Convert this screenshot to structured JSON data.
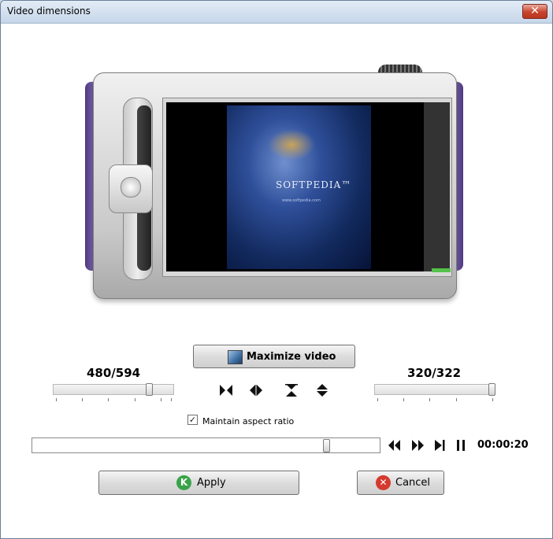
{
  "window": {
    "title": "Video dimensions",
    "close_symbol": "✕"
  },
  "preview": {
    "logo_text": "SOFTPEDIA™",
    "sub_text": "www.softpedia.com"
  },
  "controls": {
    "maximize_label": "Maximize video",
    "width_value": "480/594",
    "height_value": "320/322",
    "width_fraction": 0.81,
    "height_fraction": 0.99,
    "maintain_aspect_label": "Maintain aspect ratio",
    "maintain_aspect_checked": true,
    "position_fraction": 0.85,
    "time": "00:00:20"
  },
  "buttons": {
    "apply_label": "Apply",
    "cancel_label": "Cancel"
  },
  "icons": {
    "flip_horizontal": "flip-horizontal-icon",
    "flip_lr": "shrink-horizontal-icon",
    "hourglass": "flip-vertical-icon",
    "expand_vertical": "expand-vertical-icon",
    "rewind": "rewind-icon",
    "forward": "fast-forward-icon",
    "play": "play-step-icon",
    "pause": "pause-icon"
  },
  "colors": {
    "apply_icon": "#3aa34a",
    "cancel_icon": "#d43a2f"
  }
}
